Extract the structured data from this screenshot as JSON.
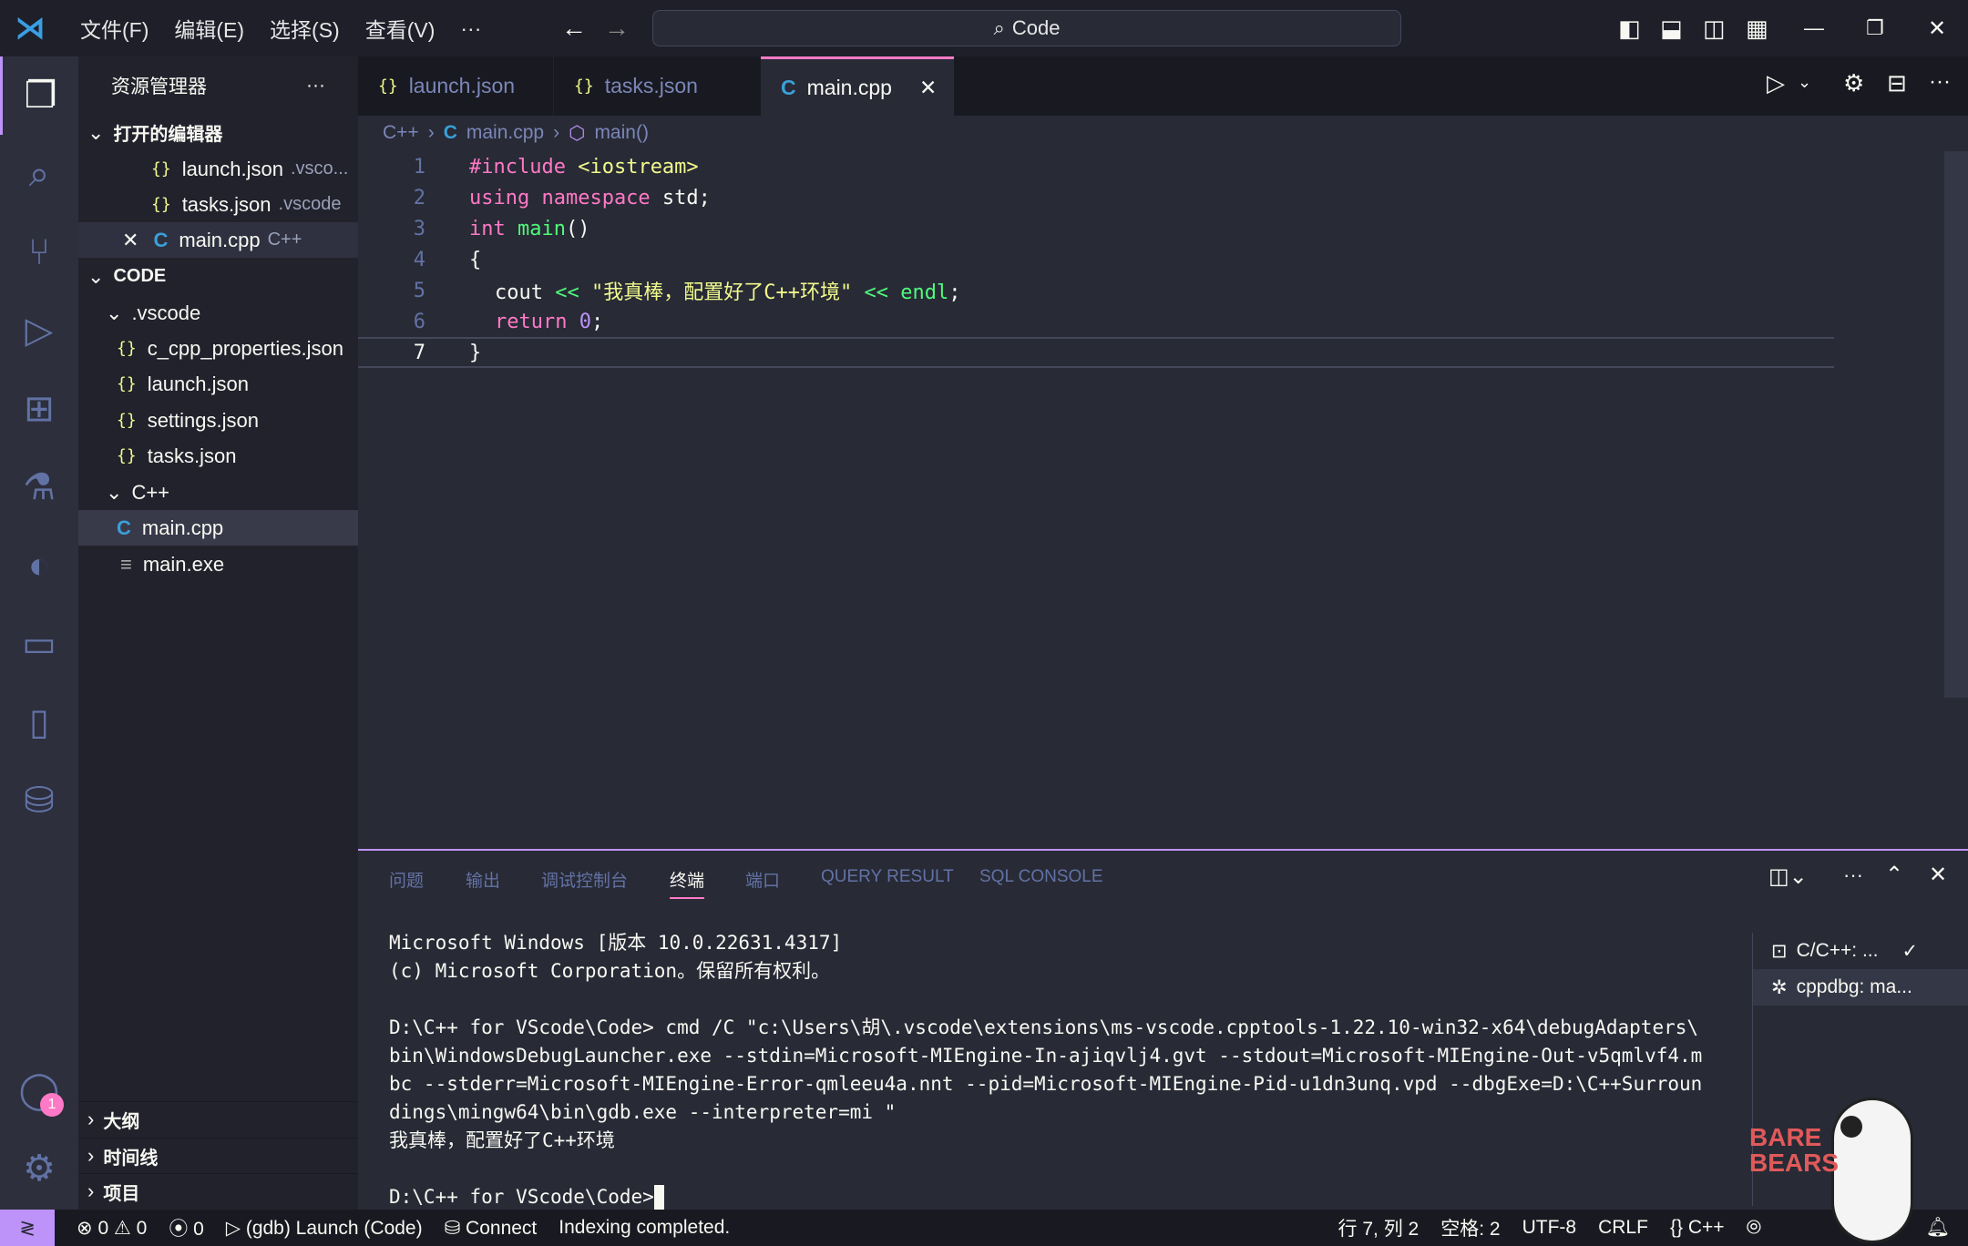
{
  "title_bar": {
    "menus": [
      "文件(F)",
      "编辑(E)",
      "选择(S)",
      "查看(V)"
    ],
    "more": "···",
    "search": "Code"
  },
  "sidebar": {
    "title": "资源管理器",
    "open_editors_label": "打开的编辑器",
    "open_editors": [
      {
        "name": "launch.json",
        "hint": ".vsco...",
        "icon": "json-icon"
      },
      {
        "name": "tasks.json",
        "hint": ".vscode",
        "icon": "json-icon"
      },
      {
        "name": "main.cpp",
        "hint": "C++",
        "icon": "cpp-icon"
      }
    ],
    "folder_label": "CODE",
    "vscode_folder": ".vscode",
    "vscode_files": [
      "c_cpp_properties.json",
      "launch.json",
      "settings.json",
      "tasks.json"
    ],
    "cpp_folder": "C++",
    "cpp_files": [
      "main.cpp",
      "main.exe"
    ],
    "bottom_sections": [
      "大纲",
      "时间线",
      "项目"
    ]
  },
  "tabs": [
    {
      "label": "launch.json"
    },
    {
      "label": "tasks.json"
    },
    {
      "label": "main.cpp",
      "active": true
    }
  ],
  "breadcrumb": [
    "C++",
    "main.cpp",
    "main()"
  ],
  "code": {
    "line_numbers": [
      "1",
      "2",
      "3",
      "4",
      "5",
      "6",
      "7"
    ],
    "l1a": "#include ",
    "l1b": "<iostream>",
    "l2a": "using namespace ",
    "l2b": "std;",
    "l3a": "int ",
    "l3b": "main",
    "l3c": "()",
    "l4": "{",
    "l5a": "cout ",
    "l5b": "<< ",
    "l5c": "\"我真棒，配置好了C++环境\"",
    "l5d": " << ",
    "l5e": "endl",
    "l5f": ";",
    "l6a": "return ",
    "l6b": "0",
    "l6c": ";",
    "l7": "}"
  },
  "panel": {
    "tabs": [
      "问题",
      "输出",
      "调试控制台",
      "终端",
      "端口",
      "QUERY RESULT",
      "SQL CONSOLE"
    ],
    "active_tab": "终端",
    "terminal_lines": [
      "Microsoft Windows [版本 10.0.22631.4317]",
      "(c) Microsoft Corporation。保留所有权利。",
      "",
      "D:\\C++ for VScode\\Code> cmd /C \"c:\\Users\\胡\\.vscode\\extensions\\ms-vscode.cpptools-1.22.10-win32-x64\\debugAdapters\\",
      "bin\\WindowsDebugLauncher.exe --stdin=Microsoft-MIEngine-In-ajiqvlj4.gvt --stdout=Microsoft-MIEngine-Out-v5qmlvf4.m",
      "bc --stderr=Microsoft-MIEngine-Error-qmleeu4a.nnt --pid=Microsoft-MIEngine-Pid-u1dn3unq.vpd --dbgExe=D:\\C++Surroun",
      "dings\\mingw64\\bin\\gdb.exe --interpreter=mi \"",
      "我真棒，配置好了C++环境",
      "",
      "D:\\C++ for VScode\\Code>"
    ],
    "terminals": [
      "C/C++: ...",
      "cppdbg: ma..."
    ]
  },
  "status": {
    "errors": "0",
    "warnings": "0",
    "ports": "0",
    "debug": "(gdb) Launch (Code)",
    "connect": "Connect",
    "indexing": "Indexing completed.",
    "position": "行 7, 列 2",
    "spaces": "空格: 2",
    "encoding": "UTF-8",
    "eol": "CRLF",
    "language": "C++"
  },
  "accounts_badge": "1",
  "colors": {
    "accent": "#bd93f9",
    "keyword": "#ff79c6",
    "function": "#50fa7b",
    "string": "#f1fa8c"
  }
}
